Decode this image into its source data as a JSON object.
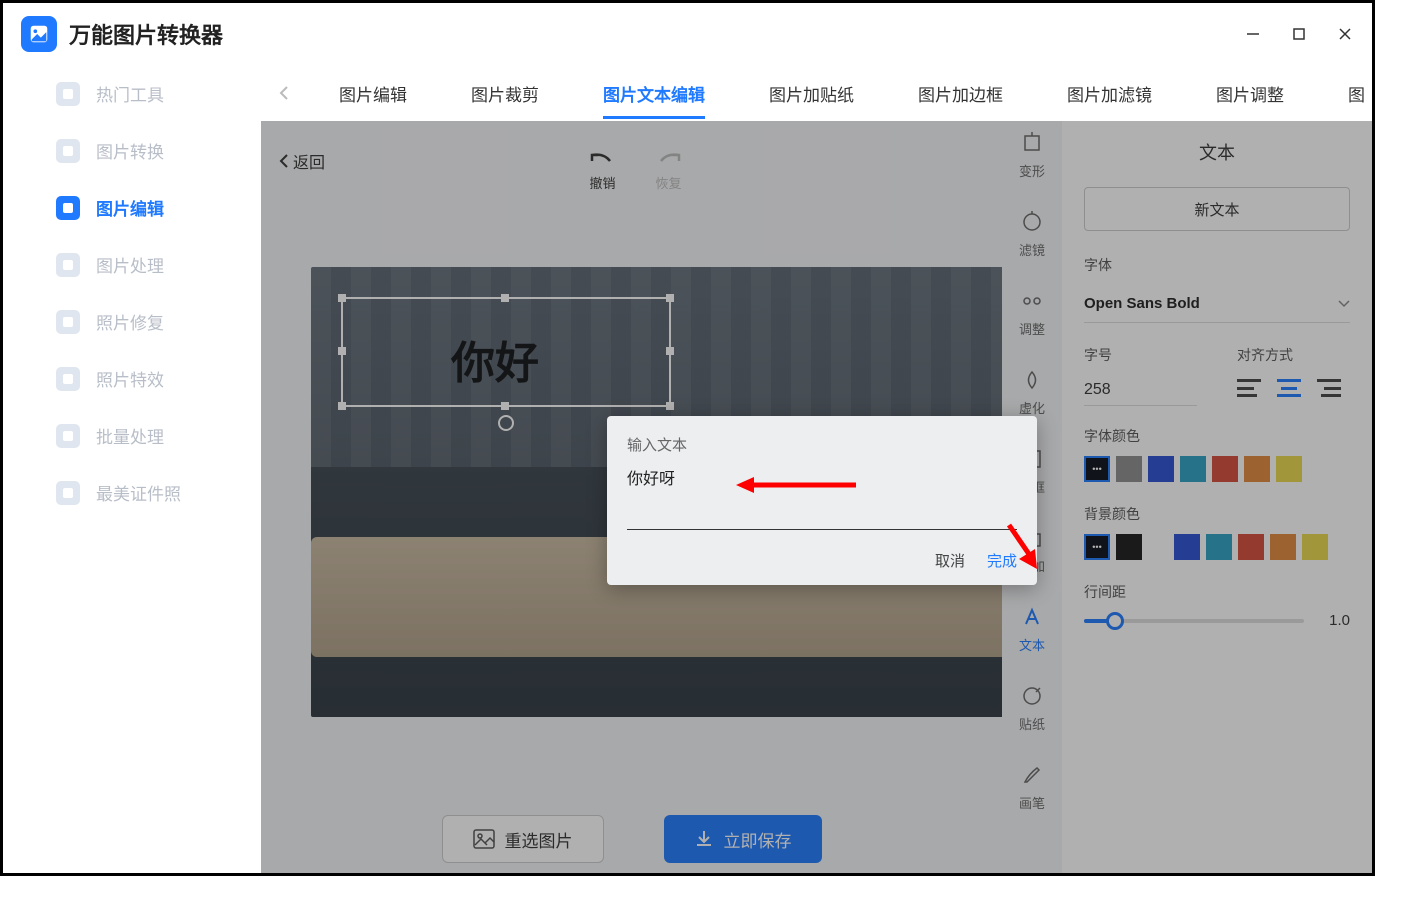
{
  "app": {
    "title": "万能图片转换器"
  },
  "sidebar": {
    "items": [
      {
        "label": "热门工具"
      },
      {
        "label": "图片转换"
      },
      {
        "label": "图片编辑"
      },
      {
        "label": "图片处理"
      },
      {
        "label": "照片修复"
      },
      {
        "label": "照片特效"
      },
      {
        "label": "批量处理"
      },
      {
        "label": "最美证件照"
      }
    ]
  },
  "tabs": {
    "items": [
      {
        "label": "图片编辑"
      },
      {
        "label": "图片裁剪"
      },
      {
        "label": "图片文本编辑"
      },
      {
        "label": "图片加贴纸"
      },
      {
        "label": "图片加边框"
      },
      {
        "label": "图片加滤镜"
      },
      {
        "label": "图片调整"
      },
      {
        "label": "图"
      }
    ]
  },
  "actionbar": {
    "back": "返回",
    "undo": "撤销",
    "redo": "恢复"
  },
  "canvas": {
    "text": "你好"
  },
  "dialog": {
    "title": "输入文本",
    "value": "你好呀",
    "cancel": "取消",
    "confirm": "完成"
  },
  "toolcol": {
    "items": [
      {
        "label": "变形"
      },
      {
        "label": "滤镜"
      },
      {
        "label": "调整"
      },
      {
        "label": "虚化"
      },
      {
        "label": "边框"
      },
      {
        "label": "叠加"
      },
      {
        "label": "文本"
      },
      {
        "label": "贴纸"
      },
      {
        "label": "画笔"
      }
    ]
  },
  "panel": {
    "title": "文本",
    "newText": "新文本",
    "fontLabel": "字体",
    "fontValue": "Open Sans Bold",
    "sizeLabel": "字号",
    "sizeValue": "258",
    "alignLabel": "对齐方式",
    "fontColorLabel": "字体颜色",
    "bgColorLabel": "背景颜色",
    "lineHeightLabel": "行间距",
    "lineHeightValue": "1.0",
    "fontColors": [
      "#0a0e1a",
      "#8c8c8c",
      "#2b4fd4",
      "#2ba0c4",
      "#d44a3a",
      "#e0873a",
      "#e8d84a"
    ],
    "bgColors": [
      "#0a0e1a",
      "#1a1a1a",
      "#2b4fd4",
      "#2ba0c4",
      "#d44a3a",
      "#e0873a",
      "#e8d84a"
    ]
  },
  "bottom": {
    "reselect": "重选图片",
    "save": "立即保存"
  }
}
